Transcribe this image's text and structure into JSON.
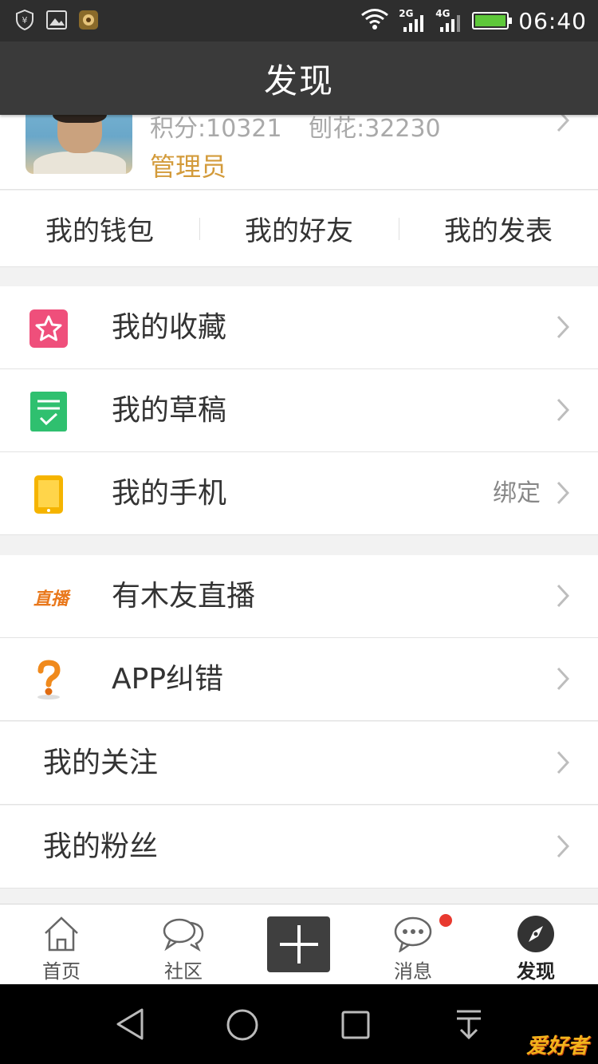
{
  "status_bar": {
    "time": "06:40",
    "network_2g": "2G",
    "network_4g": "4G",
    "icons": [
      "shield-yen-icon",
      "image-icon",
      "game-icon",
      "wifi-icon",
      "signal-icon",
      "battery-charging-icon"
    ]
  },
  "header": {
    "title": "发现"
  },
  "profile": {
    "points": "积分:10321",
    "shavings": "刨花:32230",
    "role": "管理员"
  },
  "quick_tabs": [
    {
      "label": "我的钱包"
    },
    {
      "label": "我的好友"
    },
    {
      "label": "我的发表"
    }
  ],
  "menu": {
    "favorites": {
      "label": "我的收藏",
      "icon": "star-icon"
    },
    "drafts": {
      "label": "我的草稿",
      "icon": "draft-check-icon"
    },
    "phone": {
      "label": "我的手机",
      "icon": "phone-icon",
      "extra": "绑定"
    },
    "live": {
      "label": "有木友直播",
      "icon": "live-badge-icon",
      "icon_text": "直播"
    },
    "feedback": {
      "label": "APP纠错",
      "icon": "question-mark-icon"
    },
    "following": {
      "label": "我的关注"
    },
    "fans": {
      "label": "我的粉丝"
    }
  },
  "tabbar": {
    "home": "首页",
    "community": "社区",
    "messages": "消息",
    "discover": "发现"
  },
  "watermark": "爱好者",
  "colors": {
    "header_bg": "#3a3a3a",
    "role_gold": "#d39b3b",
    "star_pink": "#ef4f7b",
    "draft_green": "#2fc06f",
    "phone_yellow": "#f5b400",
    "live_orange": "#e9781c",
    "badge_red": "#e8392f"
  }
}
